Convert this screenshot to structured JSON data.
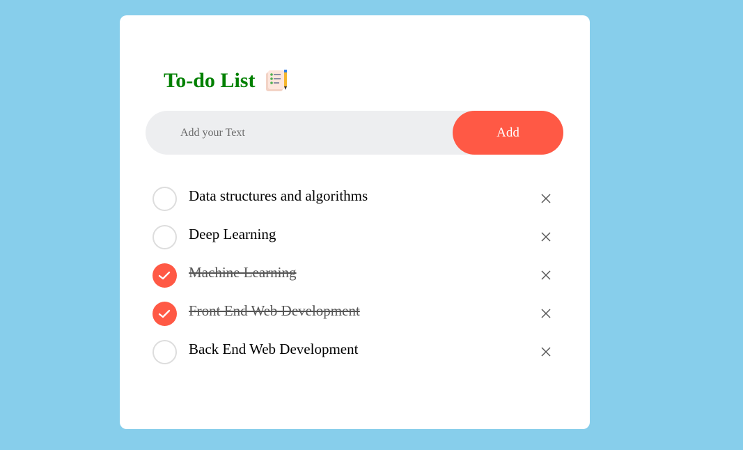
{
  "app": {
    "title": "To-do List",
    "title_icon": "notepad-pencil-icon"
  },
  "input": {
    "placeholder": "Add your Text",
    "value": ""
  },
  "add_button": {
    "label": "Add"
  },
  "tasks": [
    {
      "text": "Data structures and algorithms",
      "checked": false
    },
    {
      "text": "Deep Learning",
      "checked": false
    },
    {
      "text": "Machine Learning",
      "checked": true
    },
    {
      "text": "Front End Web Development",
      "checked": true
    },
    {
      "text": "Back End Web Development",
      "checked": false
    }
  ],
  "icons": {
    "checkbox": "check-circle-icon",
    "remove": "close-icon"
  },
  "colors": {
    "background": "#87ceeb",
    "card": "#ffffff",
    "title": "#008000",
    "accent": "#ff5945",
    "input_background": "#edeef0",
    "checkbox_border": "#dddddd"
  }
}
